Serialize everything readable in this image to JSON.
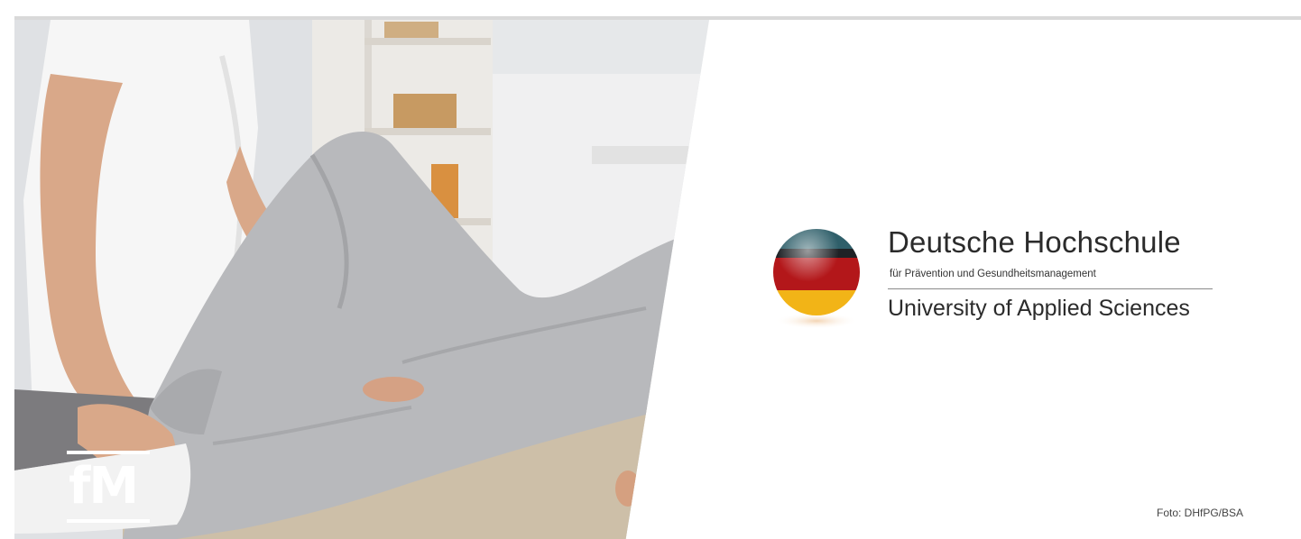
{
  "brand": {
    "fm_logo_text": "fM"
  },
  "university": {
    "name": "Deutsche Hochschule",
    "subtitle": "für Prävention und Gesundheitsmanagement",
    "english_name": "University of Applied Sciences"
  },
  "photo_credit": "Foto: DHfPG/BSA",
  "colors": {
    "flag_black": "#1f2226",
    "flag_red": "#b3171a",
    "flag_gold": "#f2b417",
    "sphere_teal": "#2f5f6a",
    "text_dark": "#2b2b2b"
  }
}
